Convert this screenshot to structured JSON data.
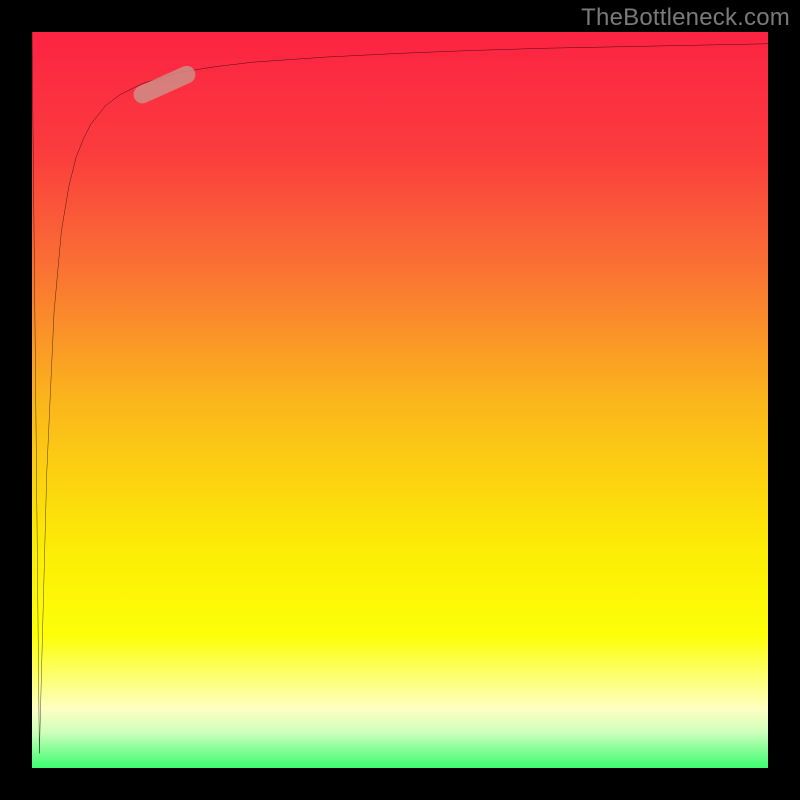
{
  "branding": {
    "watermark": "TheBottleneck.com"
  },
  "colors": {
    "page_bg": "#000000",
    "gradient_stops": [
      "#fc2343",
      "#fb3b3e",
      "#fa7134",
      "#fbb51c",
      "#fcec05",
      "#fdff08",
      "#fdffc2",
      "#d1ffbc",
      "#3cfd72"
    ],
    "curve": "#000000",
    "marker_fill": "#cf8d87",
    "marker_opacity": 0.85
  },
  "chart_data": {
    "type": "line",
    "title": "",
    "xlabel": "",
    "ylabel": "",
    "xlim": [
      0,
      100
    ],
    "ylim": [
      0,
      100
    ],
    "grid": false,
    "legend": false,
    "series": [
      {
        "name": "curve",
        "x": [
          0,
          1,
          2,
          3,
          4,
          5,
          6,
          7,
          8,
          10,
          12,
          15,
          20,
          25,
          30,
          40,
          50,
          60,
          70,
          80,
          90,
          100
        ],
        "y": [
          100,
          2,
          40,
          62,
          73,
          79,
          83,
          85.5,
          87.5,
          90,
          91.5,
          93,
          94.5,
          95.3,
          95.9,
          96.6,
          97.1,
          97.5,
          97.8,
          98.0,
          98.2,
          98.4
        ]
      }
    ],
    "annotations": [
      {
        "name": "marker-pill",
        "type": "segment",
        "x0": 15,
        "y0": 91.5,
        "x1": 21,
        "y1": 94.2
      }
    ]
  }
}
